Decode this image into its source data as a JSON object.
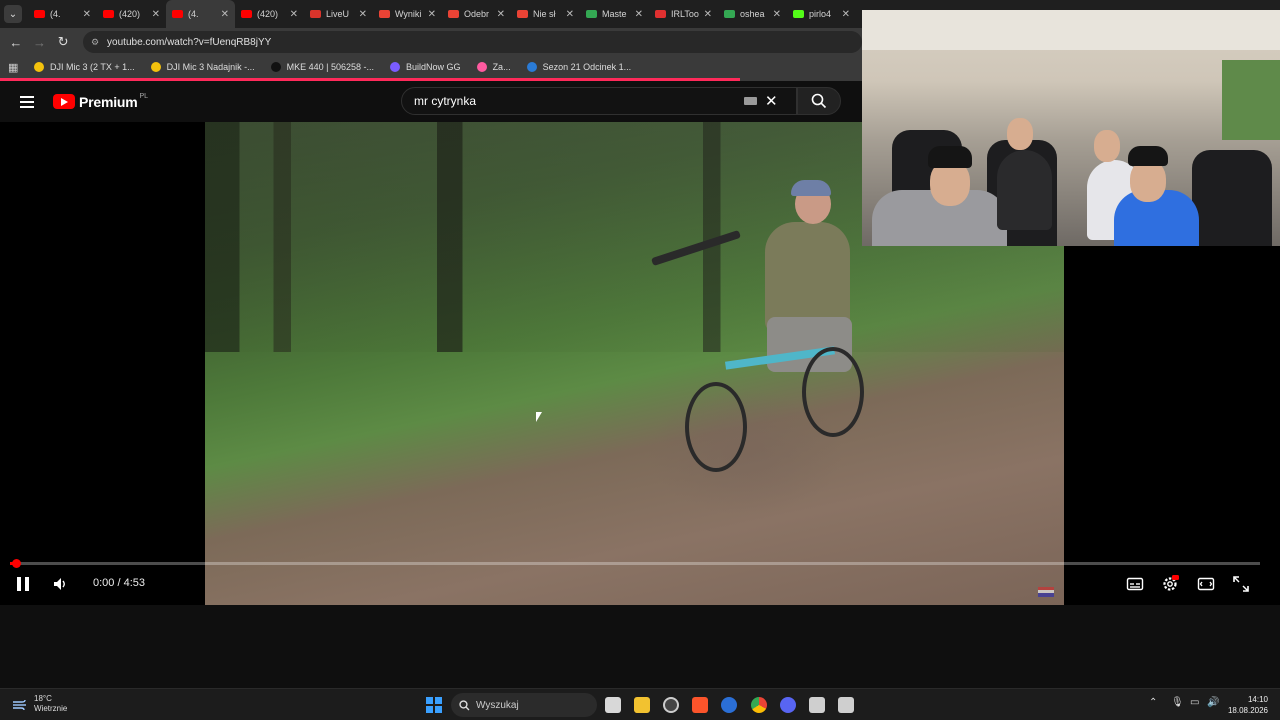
{
  "browser": {
    "tabs": [
      {
        "label": "(4.",
        "icon": "youtube-icon",
        "color": "#ff0000",
        "active": false
      },
      {
        "label": "(420)",
        "icon": "youtube-icon",
        "color": "#ff0000",
        "active": false
      },
      {
        "label": "(4.",
        "icon": "youtube-icon",
        "color": "#ff0000",
        "active": true
      },
      {
        "label": "(420)",
        "icon": "youtube-icon",
        "color": "#ff0000",
        "active": false
      },
      {
        "label": "LiveU",
        "icon": "liveu-icon",
        "color": "#d9342b",
        "active": false
      },
      {
        "label": "Wyniki",
        "icon": "gmail-icon",
        "color": "#ea4335",
        "active": false
      },
      {
        "label": "Odebr",
        "icon": "gmail-icon",
        "color": "#ea4335",
        "active": false
      },
      {
        "label": "Nie sł",
        "icon": "gmail-icon",
        "color": "#ea4335",
        "active": false
      },
      {
        "label": "Maste",
        "icon": "drive-icon",
        "color": "#34a853",
        "active": false
      },
      {
        "label": "IRLToo",
        "icon": "irltoolkit-icon",
        "color": "#e03030",
        "active": false
      },
      {
        "label": "oshea",
        "icon": "drive-icon",
        "color": "#34a853",
        "active": false
      },
      {
        "label": "pirlo4",
        "icon": "kick-icon",
        "color": "#53fc18",
        "active": false
      }
    ],
    "close_glyph": "✕",
    "url": "youtube.com/watch?v=fUenqRB8jYY",
    "bookmarks": [
      {
        "label": "DJI Mic 3 (2 TX + 1...",
        "color": "#f4c20d"
      },
      {
        "label": "DJI Mic 3 Nadajnik -...",
        "color": "#f4c20d"
      },
      {
        "label": "MKE 440 | 506258 -...",
        "color": "#111111"
      },
      {
        "label": "BuildNow GG",
        "color": "#7a5cff"
      },
      {
        "label": "Za...",
        "color": "#ff5aa0"
      },
      {
        "label": "Sezon 21 Odcinek 1...",
        "color": "#2a7bd6"
      }
    ]
  },
  "youtube": {
    "brand": "Premium",
    "region": "PL",
    "search": {
      "value": "mr cytrynka"
    },
    "player": {
      "time": "0:00 / 4:53",
      "progress_fraction": 0.005
    }
  },
  "taskbar": {
    "weather_temp": "18°C",
    "weather_desc": "Wietrznie",
    "search_label": "Wyszukaj",
    "time": "14:10",
    "date": "18.08.2026"
  },
  "colors": {
    "accent_red": "#ff0000",
    "loadbar": "#ff2a5a",
    "windows_blue": "#3aa0ff"
  }
}
